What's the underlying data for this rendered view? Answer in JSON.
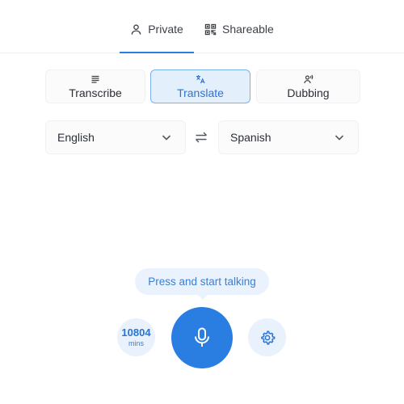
{
  "tabs": [
    {
      "label": "Private",
      "icon": "person-icon",
      "active": true
    },
    {
      "label": "Shareable",
      "icon": "qr-code-icon",
      "active": false
    }
  ],
  "modes": [
    {
      "label": "Transcribe",
      "icon": "lines-icon",
      "selected": false
    },
    {
      "label": "Translate",
      "icon": "translate-icon",
      "selected": true
    },
    {
      "label": "Dubbing",
      "icon": "voice-icon",
      "selected": false
    }
  ],
  "languages": {
    "source": "English",
    "target": "Spanish",
    "swap_icon": "swap-arrows-icon"
  },
  "hint": "Press and start talking",
  "minutes": {
    "value": "10804",
    "unit": "mins"
  },
  "colors": {
    "accent": "#2a7de1",
    "accent_light": "#e8f1fc",
    "selected_bg": "#e4effc",
    "selected_border": "#7ab0ef"
  }
}
